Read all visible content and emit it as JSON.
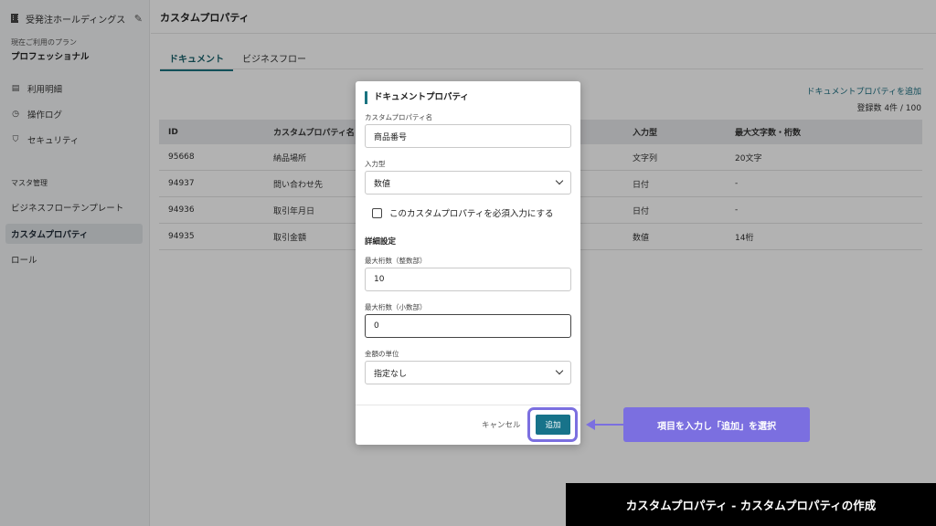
{
  "sidebar": {
    "org_name": "受発注ホールディングス",
    "plan_label": "現在ご利用のプラン",
    "plan_name": "プロフェッショナル",
    "nav": [
      {
        "label": "利用明細",
        "icon": "receipt-icon"
      },
      {
        "label": "操作ログ",
        "icon": "history-icon"
      },
      {
        "label": "セキュリティ",
        "icon": "shield-icon"
      }
    ],
    "master_section": "マスタ管理",
    "master_items": [
      {
        "label": "ビジネスフローテンプレート"
      },
      {
        "label": "カスタムプロパティ",
        "active": true
      },
      {
        "label": "ロール"
      }
    ]
  },
  "main": {
    "title": "カスタムプロパティ",
    "tabs": [
      {
        "label": "ドキュメント",
        "active": true
      },
      {
        "label": "ビジネスフロー"
      }
    ],
    "add_link": "ドキュメントプロパティを追加",
    "count": "登録数 4件 / 100",
    "table": {
      "headers": [
        "ID",
        "カスタムプロパティ名",
        "入力型",
        "最大文字数・桁数"
      ],
      "rows": [
        [
          "95668",
          "納品場所",
          "文字列",
          "20文字"
        ],
        [
          "94937",
          "問い合わせ先",
          "日付",
          "-"
        ],
        [
          "94936",
          "取引年月日",
          "日付",
          "-"
        ],
        [
          "94935",
          "取引金額",
          "数値",
          "14桁"
        ]
      ]
    }
  },
  "modal": {
    "title": "ドキュメントプロパティ",
    "name_label": "カスタムプロパティ名",
    "name_value": "商品番号",
    "type_label": "入力型",
    "type_value": "数値",
    "required_label": "このカスタムプロパティを必須入力にする",
    "detail_section": "詳細設定",
    "max_int_label": "最大桁数（整数部）",
    "max_int_value": "10",
    "max_dec_label": "最大桁数（小数部）",
    "max_dec_value": "0",
    "unit_label": "金額の単位",
    "unit_value": "指定なし",
    "cancel": "キャンセル",
    "add": "追加"
  },
  "annotation": {
    "callout": "項目を入力し「追加」を選択",
    "color": "#7b6fe0"
  },
  "caption": "カスタムプロパティ - カスタムプロパティの作成"
}
